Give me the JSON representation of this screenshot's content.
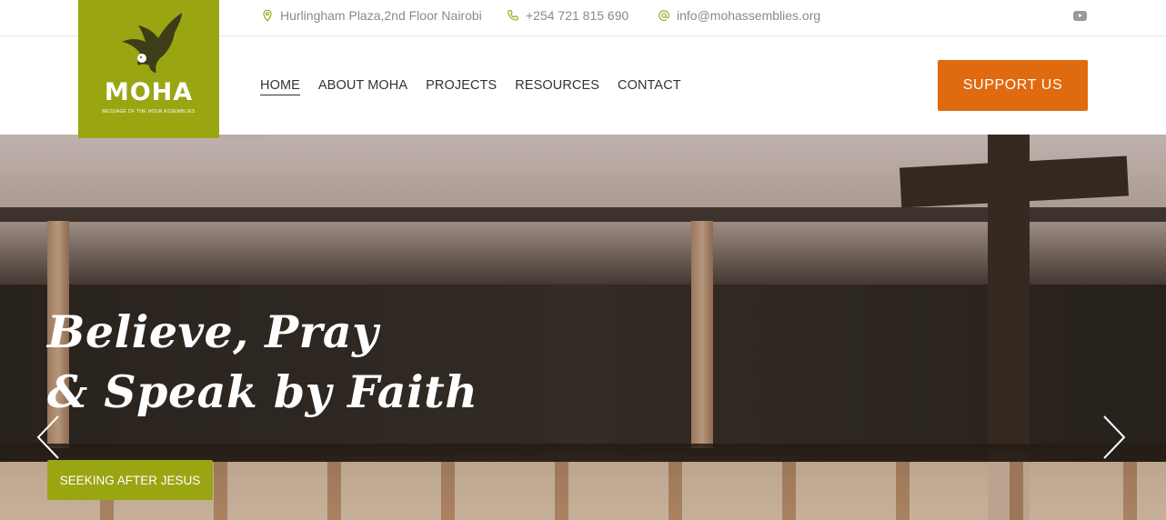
{
  "topbar": {
    "address": "Hurlingham Plaza,2nd Floor Nairobi",
    "phone": "+254 721 815 690",
    "email": "info@mohassemblies.org",
    "icons": {
      "address": "location-pin-icon",
      "phone": "phone-icon",
      "email": "at-sign-icon",
      "social": "youtube-icon"
    }
  },
  "logo": {
    "text": "MOHA",
    "tagline": "MESSAGE OF THE HOUR ASSEMBLIES",
    "background": "#9aa512"
  },
  "nav": {
    "items": [
      {
        "label": "HOME",
        "active": true
      },
      {
        "label": "ABOUT MOHA",
        "active": false
      },
      {
        "label": "PROJECTS",
        "active": false
      },
      {
        "label": "RESOURCES",
        "active": false
      },
      {
        "label": "CONTACT",
        "active": false
      }
    ]
  },
  "support_button": {
    "label": "SUPPORT US",
    "color": "#e06a10"
  },
  "hero": {
    "headline_line1": "Believe, Pray",
    "headline_line2": "& Speak by Faith",
    "cta_label": "SEEKING AFTER JESUS",
    "cta_color": "#9aa512",
    "prev_icon": "chevron-left-icon",
    "next_icon": "chevron-right-icon"
  }
}
